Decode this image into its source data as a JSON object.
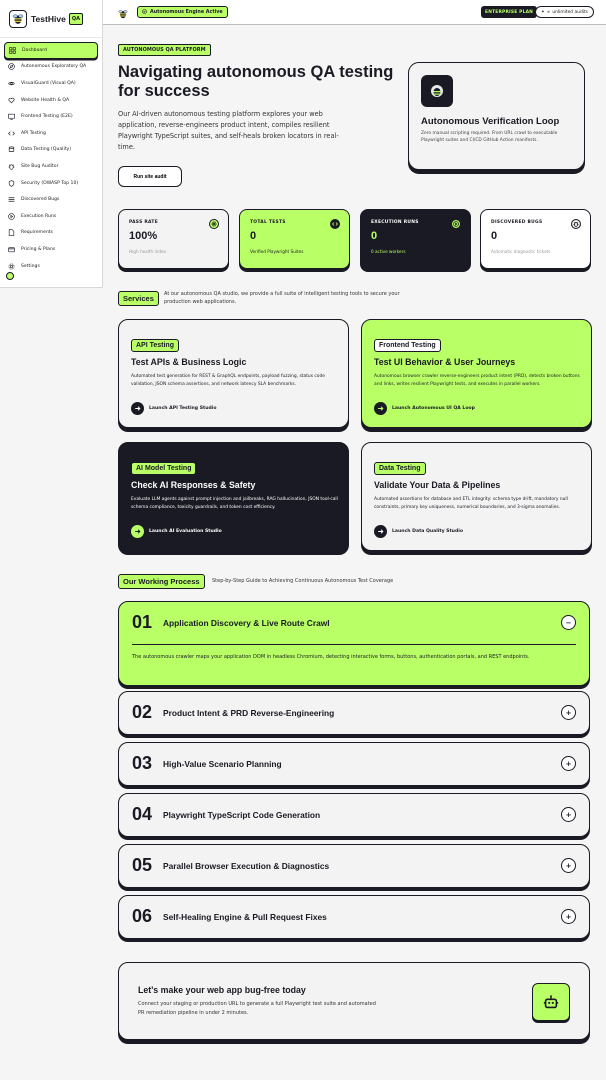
{
  "brand": {
    "name": "TestHive",
    "badge": "QA"
  },
  "sidebar": {
    "items": [
      {
        "label": "Dashboard",
        "icon": "grid-icon",
        "active": true
      },
      {
        "label": "Autonomous Exploratory QA",
        "icon": "compass-icon"
      },
      {
        "label": "VisualGuard (Visual QA)",
        "icon": "eye-icon"
      },
      {
        "label": "Website Health & QA",
        "icon": "heart-pulse-icon"
      },
      {
        "label": "Frontend Testing (E2E)",
        "icon": "monitor-icon"
      },
      {
        "label": "API Testing",
        "icon": "code-icon"
      },
      {
        "label": "Data Testing (Quality)",
        "icon": "database-icon"
      },
      {
        "label": "Site Bug Auditor",
        "icon": "bug-icon"
      },
      {
        "label": "Security (OWASP Top 10)",
        "icon": "shield-icon"
      },
      {
        "label": "Discovered Bugs",
        "icon": "list-icon"
      },
      {
        "label": "Execution Runs",
        "icon": "play-icon"
      },
      {
        "label": "Requirements",
        "icon": "file-icon"
      },
      {
        "label": "Pricing & Plans",
        "icon": "card-icon"
      },
      {
        "label": "Settings",
        "icon": "gear-icon"
      }
    ]
  },
  "topbar": {
    "engine_status": "Autonomous Engine Active",
    "plan": "ENTERPRISE PLAN",
    "audits": "unlimited audits"
  },
  "hero": {
    "tag": "AUTONOMOUS QA PLATFORM",
    "title": "Navigating autonomous QA testing for success",
    "description": "Our AI-driven autonomous testing platform explores your web application, reverse-engineers product intent, compiles resilient Playwright TypeScript suites, and self-heals broken locators in real-time.",
    "button": "Run site audit"
  },
  "verification": {
    "title": "Autonomous Verification Loop",
    "description": "Zero manual scripting required. From URL crawl to executable Playwright suites and CI/CD GitHub Action manifests."
  },
  "stats": [
    {
      "label": "PASS RATE",
      "value": "100%",
      "sub": "High health index",
      "theme": "light",
      "icon": "target-icon"
    },
    {
      "label": "TOTAL TESTS",
      "value": "0",
      "sub": "Verified Playwright Suites",
      "theme": "green",
      "icon": "code-icon"
    },
    {
      "label": "EXECUTION RUNS",
      "value": "0",
      "sub": "0 active workers",
      "theme": "dark",
      "icon": "play-icon"
    },
    {
      "label": "DISCOVERED BUGS",
      "value": "0",
      "sub": "Automatic diagnostic tickets",
      "theme": "white",
      "icon": "bug-icon"
    }
  ],
  "services": {
    "tag": "Services",
    "description": "At our autonomous QA studio, we provide a full suite of intelligent testing tools to secure your production web applications.",
    "cards": [
      {
        "tag": "API Testing",
        "title": "Test APIs & Business Logic",
        "description": "Automated test generation for REST & GraphQL endpoints, payload fuzzing, status code validation, JSON schema assertions, and network latency SLA benchmarks.",
        "link": "Launch API Testing Studio",
        "theme": "light"
      },
      {
        "tag": "Frontend Testing",
        "title": "Test UI Behavior & User Journeys",
        "description": "Autonomous browser crawler reverse-engineers product intent (PRD), detects broken buttons and links, writes resilient Playwright tests, and executes in parallel workers.",
        "link": "Launch Autonomous UI QA Loop",
        "theme": "green"
      },
      {
        "tag": "AI Model Testing",
        "title": "Check AI Responses & Safety",
        "description": "Evaluate LLM agents against prompt injection and jailbreaks, RAG hallucination, JSON tool-call schema compliance, toxicity guardrails, and token cost efficiency.",
        "link": "Launch AI Evaluation Studio",
        "theme": "dark"
      },
      {
        "tag": "Data Testing",
        "title": "Validate Your Data & Pipelines",
        "description": "Automated assertions for database and ETL integrity: schema type drift, mandatory null constraints, primary key uniqueness, numerical boundaries, and 3-sigma anomalies.",
        "link": "Launch Data Quality Studio",
        "theme": "light"
      }
    ]
  },
  "process": {
    "tag": "Our Working Process",
    "description": "Step-by-Step Guide to Achieving Continuous Autonomous Test Coverage",
    "steps": [
      {
        "num": "01",
        "title": "Application Discovery & Live Route Crawl",
        "expanded": true,
        "toggle": "−",
        "body": "The autonomous crawler maps your application DOM in headless Chromium, detecting interactive forms, buttons, authentication portals, and REST endpoints."
      },
      {
        "num": "02",
        "title": "Product Intent & PRD Reverse-Engineering",
        "toggle": "+"
      },
      {
        "num": "03",
        "title": "High-Value Scenario Planning",
        "toggle": "+"
      },
      {
        "num": "04",
        "title": "Playwright TypeScript Code Generation",
        "toggle": "+"
      },
      {
        "num": "05",
        "title": "Parallel Browser Execution & Diagnostics",
        "toggle": "+"
      },
      {
        "num": "06",
        "title": "Self-Healing Engine & Pull Request Fixes",
        "toggle": "+"
      }
    ]
  },
  "cta": {
    "title": "Let's make your web app bug-free today",
    "description": "Connect your staging or production URL to generate a full Playwright test suite and automated PR remediation pipeline in under 2 minutes.",
    "icon": "robot-icon"
  },
  "colors": {
    "accent": "#b9ff66",
    "dark": "#191a23",
    "light": "#f3f3f3"
  }
}
